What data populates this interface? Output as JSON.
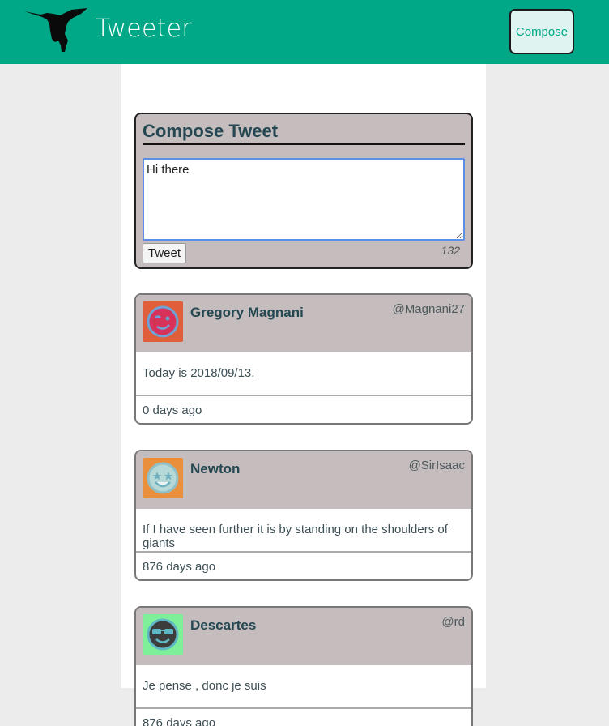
{
  "nav": {
    "brand": "Tweeter",
    "compose_label": "Compose"
  },
  "compose": {
    "title": "Compose Tweet",
    "input_value": "Hi there",
    "tweet_button": "Tweet",
    "counter": "132"
  },
  "tweets": [
    {
      "name": "Gregory Magnani",
      "handle": "@Magnani27",
      "content": "Today is 2018/09/13.",
      "age": "0 days ago",
      "avatar_icon": "winking-face-icon",
      "avatar_bg": "#e05e3a"
    },
    {
      "name": "Newton",
      "handle": "@SirIsaac",
      "content": "If I have seen further it is by standing on the shoulders of giants",
      "age": "876 days ago",
      "avatar_icon": "star-eyes-face-icon",
      "avatar_bg": "#ea8f3c"
    },
    {
      "name": "Descartes",
      "handle": "@rd",
      "content": "Je pense , donc je suis",
      "age": "876 days ago",
      "avatar_icon": "sunglasses-face-icon",
      "avatar_bg": "#7ef09a"
    }
  ],
  "colors": {
    "accent": "#00a887",
    "header_bg": "#c5bdbd",
    "text": "#244751"
  }
}
